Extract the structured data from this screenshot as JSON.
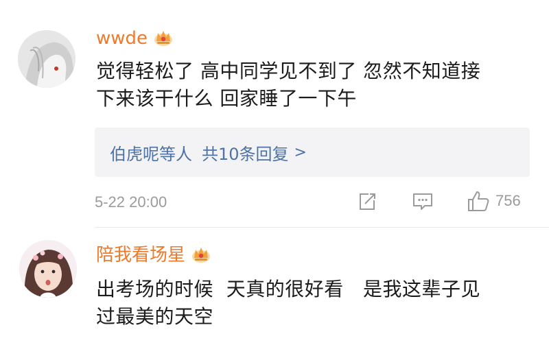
{
  "comments": [
    {
      "username": "wwde",
      "text_line1": "觉得轻松了 高中同学见不到了 忽然不知道接",
      "text_line2": "下来该干什么 回家睡了一下午",
      "reply_summary": {
        "names": "伯虎呢等人",
        "count": "共10条回复",
        "chevron": ">"
      },
      "timestamp": "5-22 20:00",
      "likes": "756",
      "icons": [
        "repost-icon",
        "comment-icon",
        "like-icon"
      ]
    },
    {
      "username": "陪我看场星",
      "text_line1": "出考场的时候  天真的很好看   是我这辈子见",
      "text_line2": "过最美的天空"
    }
  ],
  "colors": {
    "username": "#ee7a2b",
    "link": "#4c72a8",
    "meta": "#9b9b9b",
    "reply_bg": "#f3f3f5",
    "crown": "#f2a03a"
  }
}
